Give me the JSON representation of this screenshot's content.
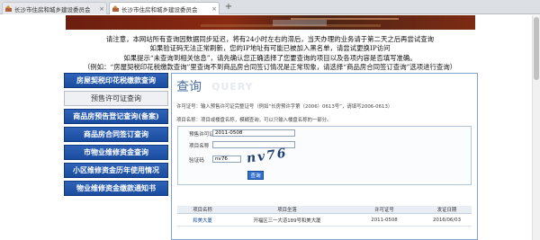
{
  "browser": {
    "tabs": [
      {
        "title": "长沙市住房和城乡建设委员会"
      },
      {
        "title": "长沙市住房和城乡建设委员会"
      }
    ],
    "new_tab": "+",
    "close_glyph": "×"
  },
  "notices": [
    "请注意，本网站所有查询因数据同步延迟，将有24小时左右的滞后，当天办理的业务请于第二天之后再尝试查询",
    "如果验证码无法正常刷新，您的IP地址有可能已被加入黑名单，请尝试更换IP访问",
    "如果提示“未查询到相关信息”，请先确认您正确选择了您要查询的项目以及各项内容是否填写准确。",
    "（例如：“房屋契税印花税缴款查询”里查询不到商品房合同签订情况是正常现象，请选择“商品房合同签订查询”选项进行查询）"
  ],
  "sidebar": {
    "items": [
      {
        "label": "房屋契税印花税缴款查询",
        "active": true
      },
      {
        "label": "预售许可证查询",
        "active": false
      },
      {
        "label": "商品房预告登记查询(备案)",
        "active": true
      },
      {
        "label": "商品房合同签订查询",
        "active": true
      },
      {
        "label": "市物业维修资金查询",
        "active": true
      },
      {
        "label": "小区维修资金历年使用情况",
        "active": true
      },
      {
        "label": "物业维修资金缴款通知书",
        "active": true
      }
    ]
  },
  "query": {
    "title": "查询",
    "subtitle": "QUERY",
    "hint1": "许可证号：输入预售许可证完整证号（例如“长房预许字第（2006）0613号”，请填写2006-0613）",
    "hint2": "项目名称：项目或楼盘名称，模糊查询，可以只输入楼盘名称的一部分。",
    "fields": {
      "permit_label": "预售许可证号",
      "permit_value": "2011-0508",
      "project_label": "项目名称",
      "project_value": "",
      "captcha_label": "验证码",
      "captcha_value": "nv76"
    },
    "captcha_image_text": "nv76",
    "submit_label": "查询"
  },
  "results": {
    "headers": [
      "项目名称",
      "项目坐落",
      "许可证号",
      "发证日期"
    ],
    "rows": [
      [
        "和美大厦",
        "开福区三一大道189号和美大厦",
        "2011-0508",
        "2016/06/03"
      ]
    ]
  }
}
